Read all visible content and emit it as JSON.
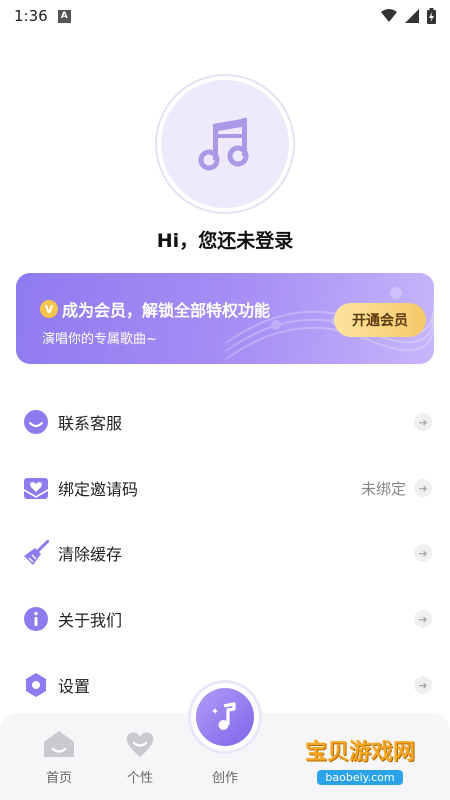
{
  "status_bar": {
    "time": "1:36",
    "app_indicator": "A"
  },
  "profile": {
    "greeting": "Hi，您还未登录"
  },
  "vip": {
    "badge": "V",
    "title": "成为会员，解锁全部特权功能",
    "subtitle": "演唱你的专属歌曲~",
    "button": "开通会员"
  },
  "menu": [
    {
      "label": "联系客服",
      "value": ""
    },
    {
      "label": "绑定邀请码",
      "value": "未绑定"
    },
    {
      "label": "清除缓存",
      "value": ""
    },
    {
      "label": "关于我们",
      "value": ""
    },
    {
      "label": "设置",
      "value": ""
    }
  ],
  "nav": {
    "home": "首页",
    "personal": "个性",
    "create": "创作"
  },
  "watermark": {
    "title": "宝贝游戏网",
    "url": "baobeiy.com"
  },
  "colors": {
    "accent": "#8f7af0",
    "gold": "#f6c968"
  }
}
